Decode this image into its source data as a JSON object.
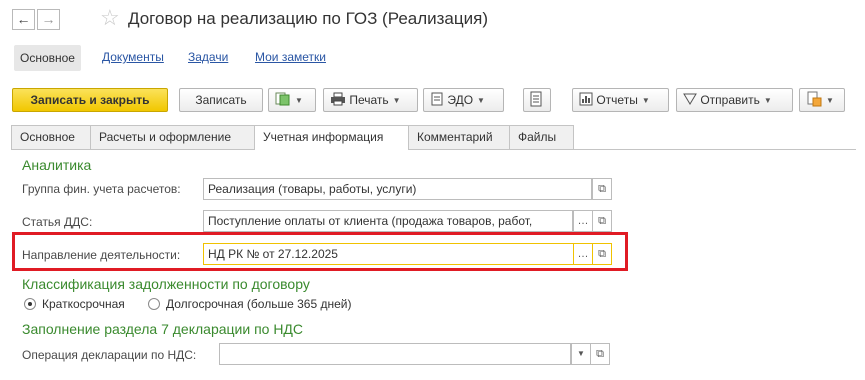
{
  "window": {
    "title": "Договор на реализацию по ГОЗ (Реализация)"
  },
  "nav": {
    "back_glyph": "←",
    "forward_glyph": "→",
    "favorite_icon": "star-icon"
  },
  "sections": {
    "active": "Основное",
    "links": [
      "Документы",
      "Задачи",
      "Мои заметки"
    ]
  },
  "toolbar": {
    "save_close": "Записать и закрыть",
    "save": "Записать",
    "print": "Печать",
    "edo": "ЭДО",
    "reports": "Отчеты",
    "send": "Отправить"
  },
  "tabs": [
    "Основное",
    "Расчеты и оформление",
    "Учетная информация",
    "Комментарий",
    "Файлы"
  ],
  "form": {
    "analytics_header": "Аналитика",
    "fin_group_label": "Группа фин. учета расчетов:",
    "fin_group_value": "Реализация (товары, работы, услуги)",
    "dds_label": "Статья ДДС:",
    "dds_value": "Поступление оплаты от клиента (продажа товаров, работ,",
    "direction_label": "Направление деятельности:",
    "direction_value": "НД РК № от 27.12.2025",
    "debt_header": "Классификация задолженности по договору",
    "short_term": "Краткосрочная",
    "long_term": "Долгосрочная (больше 365 дней)",
    "debt_selected": "Краткосрочная",
    "vat_header": "Заполнение раздела 7 декларации по НДС",
    "vat_label": "Операция декларации по НДС:",
    "vat_value": ""
  },
  "colors": {
    "accent_green": "#3a8a2e",
    "link_blue": "#2a56a4",
    "highlight_red": "#e01b24",
    "primary_yellow": "#f1c700"
  }
}
